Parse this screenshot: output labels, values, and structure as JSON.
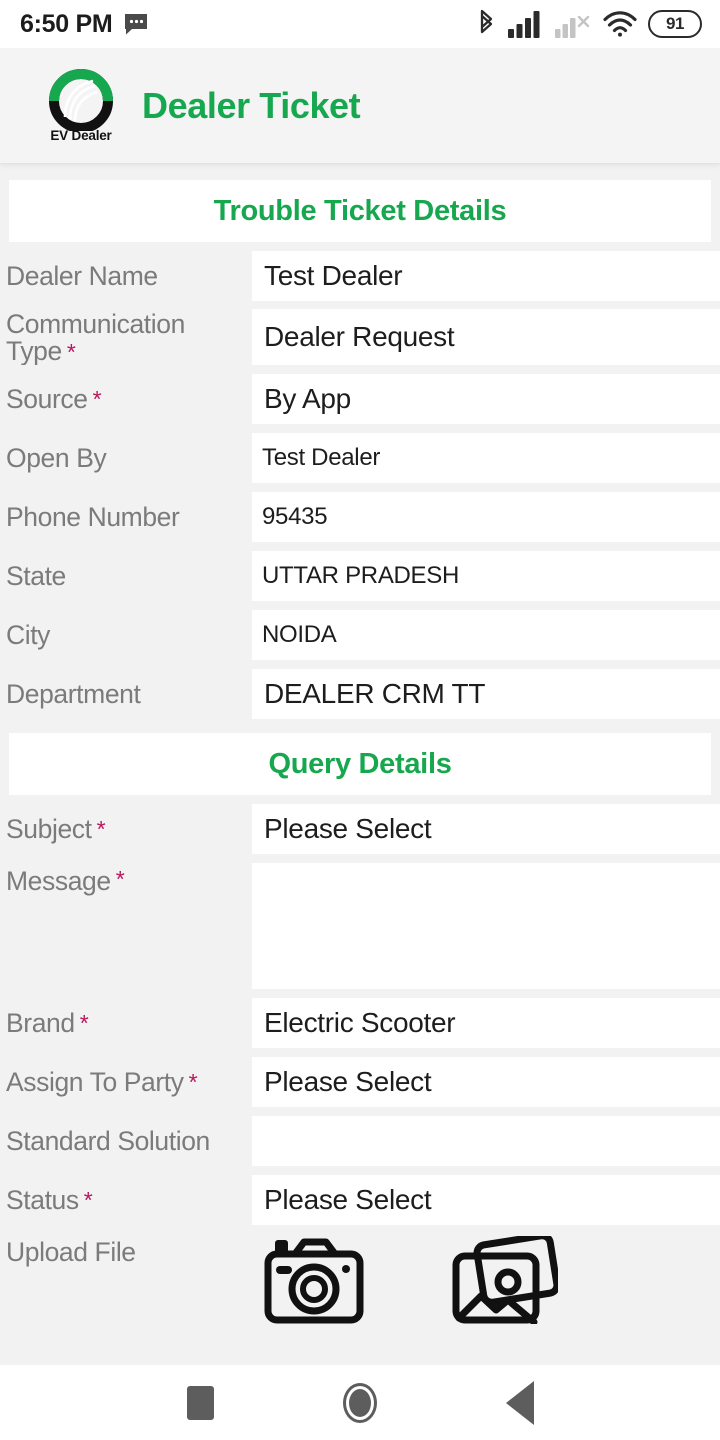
{
  "status_bar": {
    "time": "6:50 PM",
    "message_icon": "message-icon",
    "bluetooth_icon": "bluetooth-icon",
    "signal_icon": "cellular-signal-icon",
    "signal_off_icon": "cellular-signal-unavailable-icon",
    "wifi_icon": "wifi-icon",
    "battery_level": "91"
  },
  "header": {
    "logo_text": "EV Dealer",
    "title": "Dealer Ticket",
    "accent_color": "#17a84f"
  },
  "sections": {
    "ticket_details_title": "Trouble Ticket Details",
    "query_details_title": "Query Details"
  },
  "colors": {
    "accent_green": "#17a84f",
    "required_red": "#b8175c",
    "label_gray": "#7b7b7b",
    "page_bg": "#f2f2f2",
    "field_bg": "#ffffff"
  },
  "ticket_fields": [
    {
      "label": "Dealer Name",
      "required": false,
      "value": "Test Dealer"
    },
    {
      "label": "Communication Type",
      "required": true,
      "value": "Dealer Request"
    },
    {
      "label": "Source",
      "required": true,
      "value": "By App"
    },
    {
      "label": "Open By",
      "required": false,
      "value": "Test Dealer"
    },
    {
      "label": "Phone Number",
      "required": false,
      "value": "95435"
    },
    {
      "label": "State",
      "required": false,
      "value": "UTTAR PRADESH"
    },
    {
      "label": "City",
      "required": false,
      "value": "NOIDA"
    },
    {
      "label": "Department",
      "required": false,
      "value": "DEALER CRM TT"
    }
  ],
  "query_fields": [
    {
      "label": "Subject",
      "required": true,
      "value": "Please Select"
    },
    {
      "label": "Message",
      "required": true,
      "value": ""
    },
    {
      "label": "Brand",
      "required": true,
      "value": "Electric Scooter"
    },
    {
      "label": "Assign To Party",
      "required": true,
      "value": "Please Select"
    },
    {
      "label": "Standard Solution",
      "required": false,
      "value": ""
    },
    {
      "label": "Status",
      "required": true,
      "value": "Please Select"
    }
  ],
  "upload": {
    "label": "Upload File",
    "camera_icon": "camera-icon",
    "gallery_icon": "gallery-icon"
  },
  "nav_bar": {
    "recents": "recents-button",
    "home": "home-button",
    "back": "back-button"
  },
  "labels": {
    "dealer_name": "Dealer Name",
    "communication_type": "Communication Type",
    "source": "Source",
    "open_by": "Open By",
    "phone_number": "Phone Number",
    "state": "State",
    "city": "City",
    "department": "Department",
    "subject": "Subject",
    "message": "Message",
    "brand": "Brand",
    "assign_to_party": "Assign To Party",
    "standard_solution": "Standard Solution",
    "status": "Status",
    "upload_file": "Upload File"
  },
  "values": {
    "dealer_name": "Test Dealer",
    "communication_type": "Dealer Request",
    "source": "By App",
    "open_by": "Test Dealer",
    "phone_number": "95435",
    "state": "UTTAR PRADESH",
    "city": "NOIDA",
    "department": "DEALER CRM TT",
    "subject": "Please Select",
    "message": "",
    "brand": "Electric Scooter",
    "assign_to_party": "Please Select",
    "standard_solution": "",
    "status": "Please Select"
  }
}
